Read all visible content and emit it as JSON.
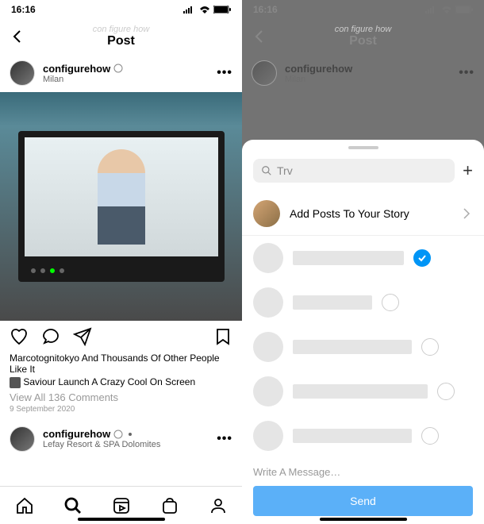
{
  "status": {
    "time": "16:16"
  },
  "header": {
    "watermark": "con figure how",
    "title": "Post"
  },
  "post": {
    "username": "configurehow",
    "location": "Milan",
    "likes_text": "Marcotognitokyo And Thousands Of Other People Like It",
    "caption": "Saviour Launch A Crazy Cool On Screen",
    "comments_link": "View All 136 Comments",
    "date": "9 September 2020"
  },
  "post2": {
    "username": "configurehow",
    "location": "Lefay Resort & SPA Dolomites"
  },
  "share": {
    "search_placeholder": "Trv",
    "story_label": "Add Posts To Your Story",
    "message_placeholder": "Write A Message…",
    "send_label": "Send"
  }
}
